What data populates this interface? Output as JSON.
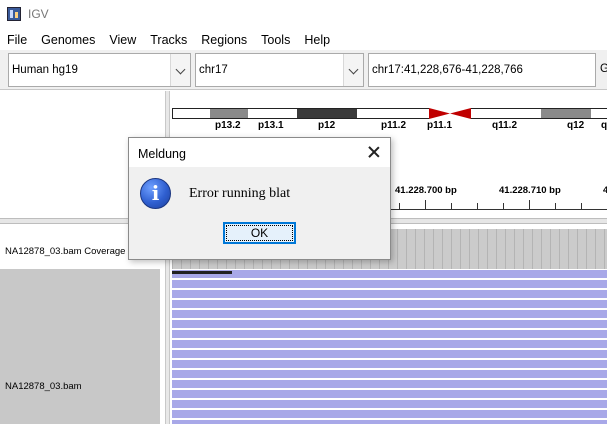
{
  "window": {
    "title": "IGV"
  },
  "menu": [
    "File",
    "Genomes",
    "View",
    "Tracks",
    "Regions",
    "Tools",
    "Help"
  ],
  "toolbar": {
    "genome": "Human hg19",
    "chromosome": "chr17",
    "locus": "chr17:41,228,676-41,228,766",
    "go_partial": "G"
  },
  "ideogram": {
    "bands": [
      "p13.2",
      "p13.1",
      "p12",
      "p11.2",
      "p11.1",
      "q11.2",
      "q12",
      "q"
    ]
  },
  "ruler": {
    "labels": [
      "41.228.700 bp",
      "41.228.710 bp",
      "4"
    ]
  },
  "tracks": {
    "coverage_label": "NA12878_03.bam Coverage",
    "alignment_label": "NA12878_03.bam"
  },
  "dialog": {
    "title": "Meldung",
    "message": "Error running blat",
    "ok_label": "OK"
  },
  "icons": {
    "app": "igv-app-icon",
    "dropdown": "chevron-down-icon",
    "close": "close-icon",
    "info": "info-icon"
  },
  "colors": {
    "accent": "#0078d7",
    "reads": "#a8a8e8",
    "centromere": "#c00000"
  }
}
